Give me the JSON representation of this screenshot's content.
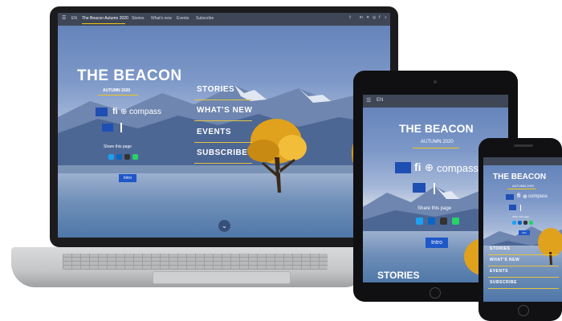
{
  "laptop": {
    "nav": {
      "lang": "EN",
      "site_title": "The Beacon Autumn 2020",
      "links": [
        "Stories",
        "What's new",
        "Events",
        "Subscribe"
      ]
    },
    "hero": {
      "title": "THE BEACON",
      "subtitle": "AUTUMN 2020",
      "fi_compass": "compass",
      "share_label": "Share this page",
      "intro_button": "Intro"
    },
    "menu": [
      "STORIES",
      "WHAT'S NEW",
      "EVENTS",
      "SUBSCRIBE"
    ]
  },
  "tablet": {
    "nav": {
      "lang": "EN"
    },
    "hero": {
      "title": "THE BEACON",
      "subtitle": "AUTUMN 2020",
      "fi_compass": "compass",
      "share_label": "Share this page",
      "intro_button": "Intro"
    },
    "stories_heading": "STORIES"
  },
  "phone": {
    "hero": {
      "title": "THE BEACON",
      "subtitle": "AUTUMN 2020",
      "fi_compass": "compass",
      "share_label": "Share this page",
      "intro_button": "Intro"
    },
    "menu": [
      "STORIES",
      "WHAT'S NEW",
      "EVENTS",
      "SUBSCRIBE"
    ]
  },
  "colors": {
    "accent": "#f0c419",
    "intro_button": "#1f57c8",
    "twitter": "#1da1f2",
    "linkedin": "#0a66c2",
    "email": "#333333",
    "whatsapp": "#25d366"
  }
}
